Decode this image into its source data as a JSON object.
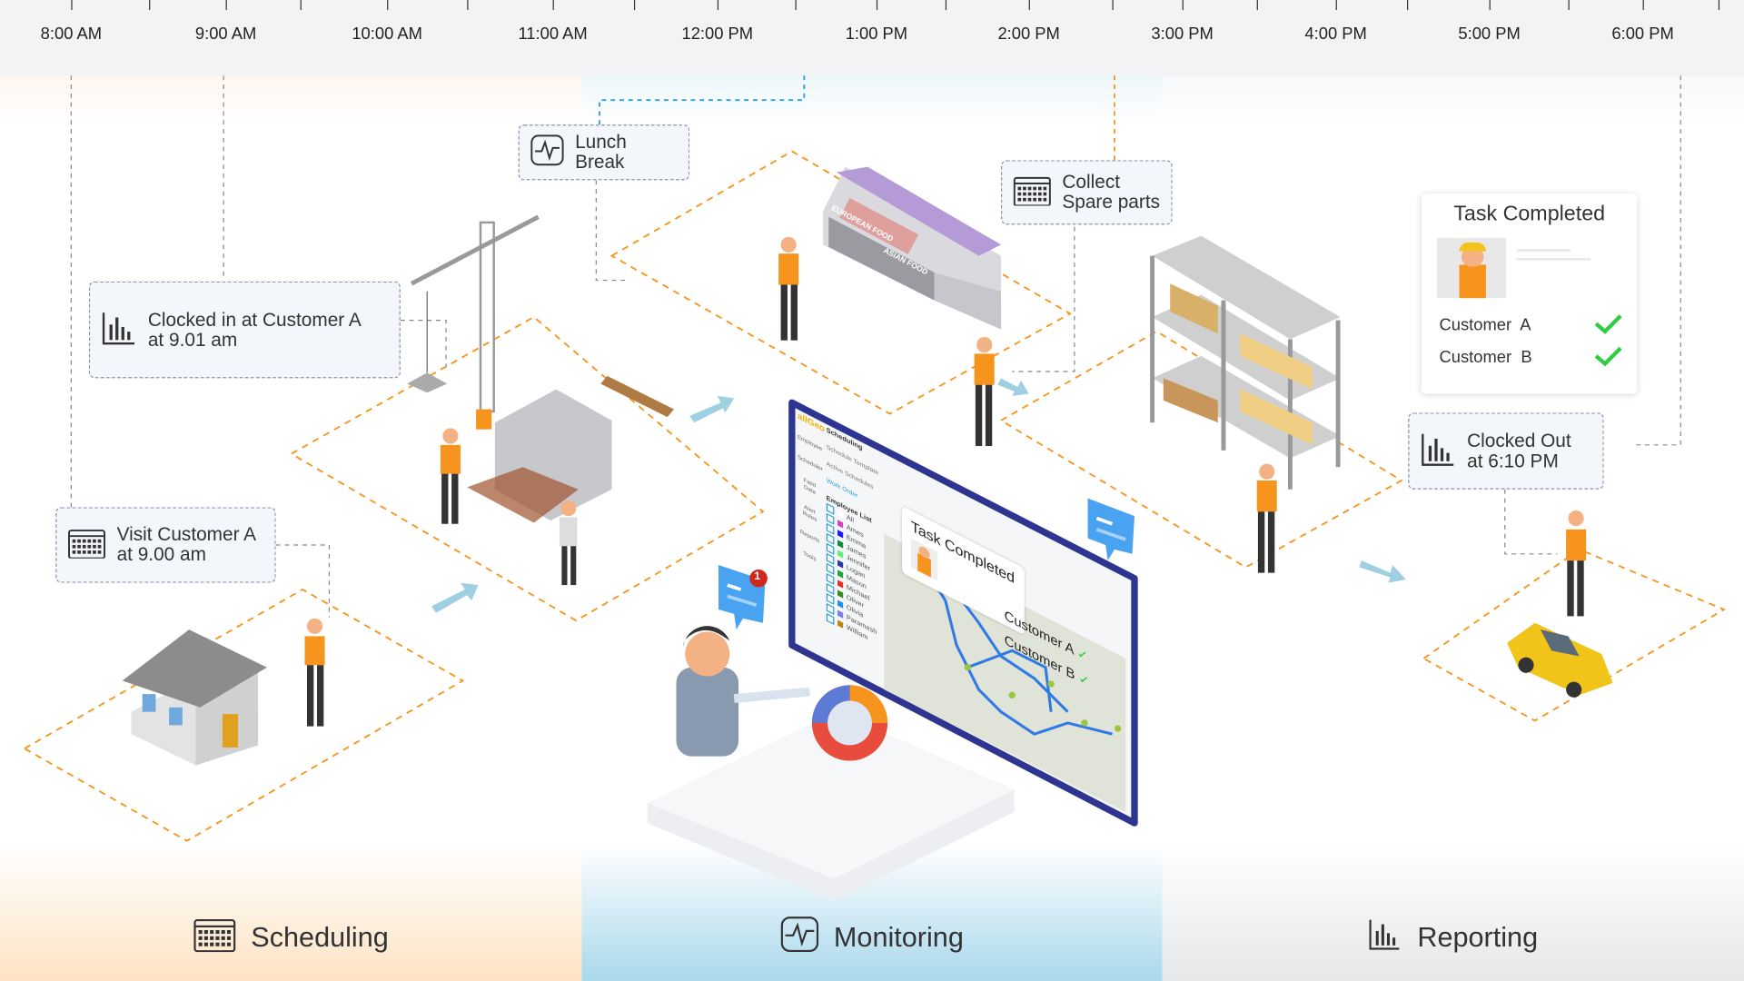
{
  "timeline": [
    "8:00 AM",
    "9:00 AM",
    "10:00 AM",
    "11:00 AM",
    "12:00 PM",
    "1:00 PM",
    "2:00 PM",
    "3:00 PM",
    "4:00 PM",
    "5:00 PM",
    "6:00 PM"
  ],
  "callouts": {
    "lunch": {
      "label": "Lunch Break",
      "icon": "pulse-icon"
    },
    "spare": {
      "line1": "Collect",
      "line2": "Spare parts",
      "icon": "calendar-icon"
    },
    "clockin": {
      "line1": "Clocked in at Customer A",
      "line2": "at 9.01 am",
      "icon": "bar-chart-icon"
    },
    "visit": {
      "line1": "Visit Customer A",
      "line2": "at 9.00 am",
      "icon": "calendar-icon"
    },
    "clockout": {
      "line1": "Clocked Out",
      "line2": "at 6:10 PM",
      "icon": "bar-chart-icon"
    }
  },
  "task_card": {
    "title": "Task Completed",
    "rows": [
      "Customer  A",
      "Customer  B"
    ]
  },
  "stall": {
    "sign1": "EUROPEAN FOOD",
    "sign2": "ASIAN FOOD"
  },
  "monitor": {
    "logo": "allGeo",
    "nav": [
      "Employee",
      "Scheduler",
      "Field Data",
      "Alert Rules",
      "Reports",
      "Tools"
    ],
    "menu_title": "Scheduling",
    "menu": [
      "Schedule Template",
      "Active Schedules",
      "Work Order"
    ],
    "employee_list_title": "Employee List",
    "employees": [
      {
        "name": "All",
        "color": "#ffffff"
      },
      {
        "name": "Ames",
        "color": "#d63fc4"
      },
      {
        "name": "Emma",
        "color": "#1a1aff"
      },
      {
        "name": "James",
        "color": "#118a3a"
      },
      {
        "name": "Jennifer",
        "color": "#5cf07a"
      },
      {
        "name": "Logan",
        "color": "#2a3aa8"
      },
      {
        "name": "Mason",
        "color": "#18a83a"
      },
      {
        "name": "Michael",
        "color": "#e0301e"
      },
      {
        "name": "Oliver",
        "color": "#3c8a1a"
      },
      {
        "name": "Olivia",
        "color": "#1e8ef0"
      },
      {
        "name": "Paramesh",
        "color": "#7a7af0"
      },
      {
        "name": "William",
        "color": "#b8860b"
      }
    ],
    "task_title": "Task Completed",
    "customers": [
      "Customer A",
      "Customer B"
    ]
  },
  "notification_count": "1",
  "sections": [
    {
      "label": "Scheduling",
      "icon": "calendar-icon"
    },
    {
      "label": "Monitoring",
      "icon": "pulse-icon"
    },
    {
      "label": "Reporting",
      "icon": "bar-chart-icon"
    }
  ],
  "colors": {
    "accent_orange": "#f7941d",
    "accent_blue": "#9fd3e8",
    "check_green": "#2ecc40",
    "monitor_frame": "#2d3590"
  }
}
